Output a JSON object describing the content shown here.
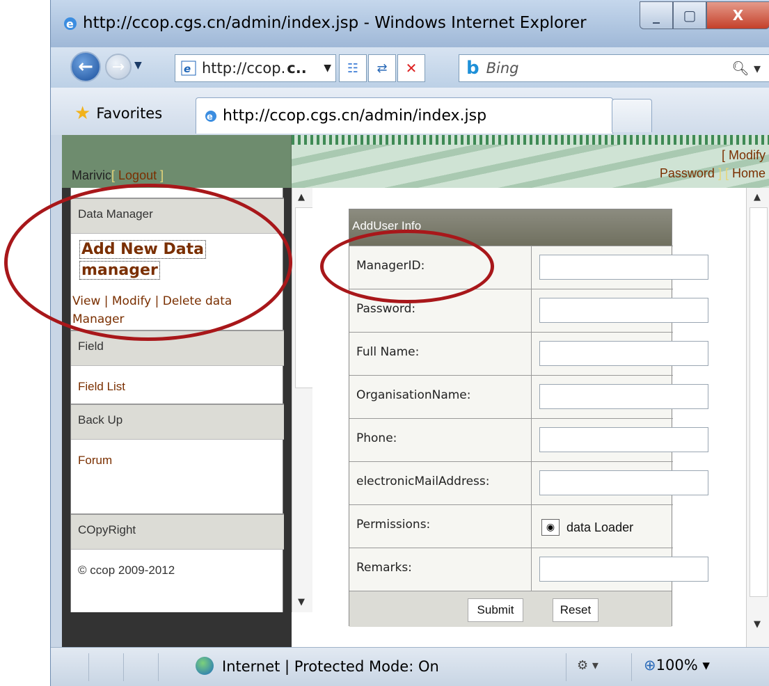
{
  "window": {
    "title": "http://ccop.cgs.cn/admin/index.jsp - Windows Internet Explorer",
    "controls": {
      "minimize": "_",
      "maximize": "▢",
      "close": "X"
    }
  },
  "navigation": {
    "address_text": "http://ccop.",
    "address_bold": "c..",
    "search_placeholder": "Bing",
    "search_logo": "b"
  },
  "favorites_bar": {
    "favorites_label": "Favorites",
    "active_tab": "http://ccop.cgs.cn/admin/index.jsp"
  },
  "header": {
    "user": "Marivic",
    "open_bracket": "[",
    "logout": "Logout",
    "close_bracket": "]",
    "links_line1": "[ Modify",
    "password_link": "Password",
    "links_sep": "] [",
    "home_link": "Home"
  },
  "sidebar": {
    "data_manager": "Data Manager",
    "add_new_line1": "Add New Data",
    "add_new_line2": "manager",
    "view_modify_delete": "View | Modify | Delete data Manager",
    "field": "Field",
    "field_list": "Field List",
    "backup": "Back Up",
    "forum": "Forum",
    "copyright_label": "COpyRight",
    "copyright_text": "© ccop 2009-2012"
  },
  "form": {
    "title": "AddUser Info",
    "fields": [
      {
        "label": "ManagerID:",
        "value": ""
      },
      {
        "label": "Password:",
        "value": ""
      },
      {
        "label": "Full Name:",
        "value": ""
      },
      {
        "label": "OrganisationName:",
        "value": ""
      },
      {
        "label": "Phone:",
        "value": ""
      },
      {
        "label": "electronicMailAddress:",
        "value": ""
      }
    ],
    "permissions_label": "Permissions:",
    "permissions_option": "data Loader",
    "permissions_selected": true,
    "remarks_label": "Remarks:",
    "submit": "Submit",
    "reset": "Reset"
  },
  "status_bar": {
    "zone": "Internet | Protected Mode: On",
    "zoom": "100%"
  },
  "colors": {
    "link": "#7a2f00",
    "annotation": "#a8171a",
    "header_green": "#6e8c6e"
  }
}
